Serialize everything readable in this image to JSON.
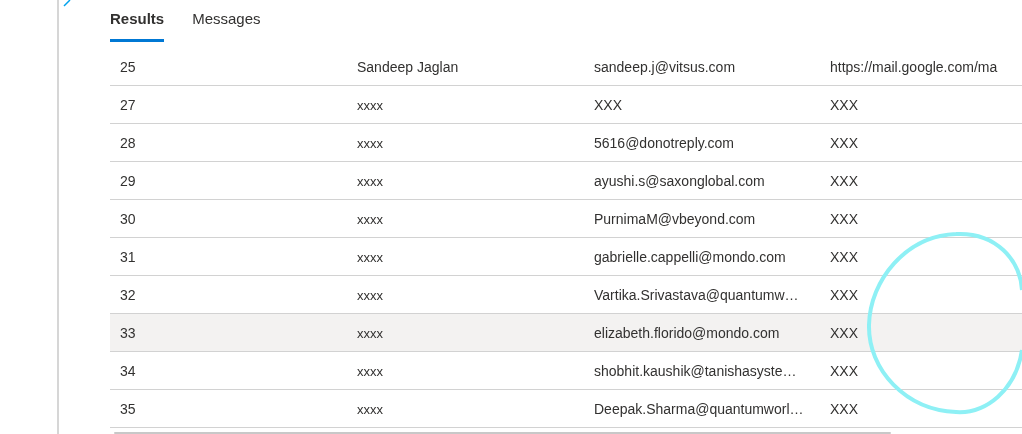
{
  "tabs": [
    {
      "label": "Results",
      "selected": true
    },
    {
      "label": "Messages",
      "selected": false
    }
  ],
  "rows": [
    {
      "cells": [
        "25",
        "Sandeep Jaglan",
        "sandeep.j@vitsus.com",
        "https://mail.google.com/ma"
      ],
      "selected": false
    },
    {
      "cells": [
        "27",
        "xxxx",
        "XXX",
        "XXX"
      ],
      "selected": false
    },
    {
      "cells": [
        "28",
        "xxxx",
        "5616@donotreply.com",
        "XXX"
      ],
      "selected": false
    },
    {
      "cells": [
        "29",
        "xxxx",
        "ayushi.s@saxonglobal.com",
        "XXX"
      ],
      "selected": false
    },
    {
      "cells": [
        "30",
        "xxxx",
        "PurnimaM@vbeyond.com",
        "XXX"
      ],
      "selected": false
    },
    {
      "cells": [
        "31",
        "xxxx",
        "gabrielle.cappelli@mondo.com",
        "XXX"
      ],
      "selected": false
    },
    {
      "cells": [
        "32",
        "xxxx",
        "Vartika.Srivastava@quantumw…",
        "XXX"
      ],
      "selected": false
    },
    {
      "cells": [
        "33",
        "xxxx",
        "elizabeth.florido@mondo.com",
        "XXX"
      ],
      "selected": true
    },
    {
      "cells": [
        "34",
        "xxxx",
        "shobhit.kaushik@tanishasyste…",
        "XXX"
      ],
      "selected": false
    },
    {
      "cells": [
        "35",
        "xxxx",
        "Deepak.Sharma@quantumworl…",
        "XXX"
      ],
      "selected": false
    }
  ]
}
